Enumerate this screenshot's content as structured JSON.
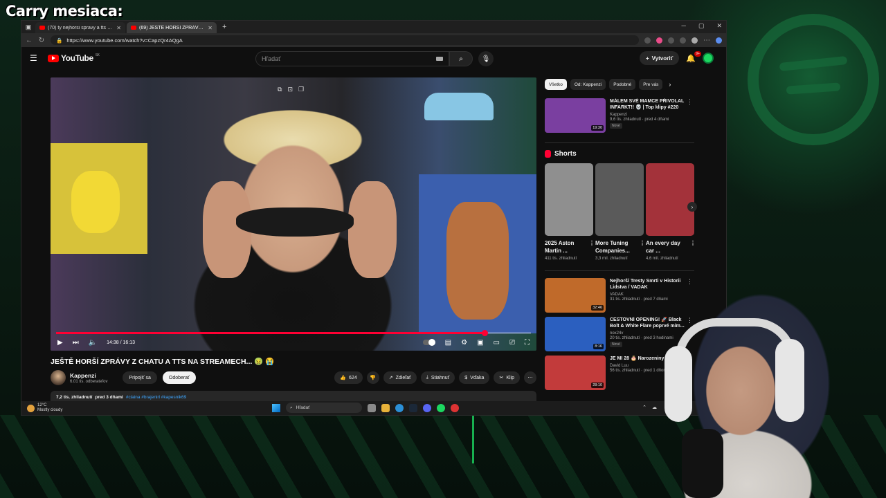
{
  "overlay": {
    "title": "Carry mesiaca:"
  },
  "browser": {
    "tabs": [
      {
        "label": "(70) ty nejhorsi spravy a tts na stream",
        "active": false
      },
      {
        "label": "(69) JEŠTĚ HORŠÍ ZPRÁVY Z CHATU A TTS",
        "active": true
      }
    ],
    "url": "https://www.youtube.com/watch?v=CapzQr4AQgA"
  },
  "youtube": {
    "logo_text": "YouTube",
    "logo_suffix": "SK",
    "search_placeholder": "Hľadať",
    "create_label": "Vytvoriť",
    "notification_count": "9+",
    "player": {
      "time_current": "14:38",
      "time_total": "16:13",
      "progress_fraction": 0.902
    },
    "video": {
      "title": "JEŠTĚ HORŠÍ ZPRÁVY Z CHATU A TTS NA STREAMECH... 🤢 😭",
      "channel": "Kappenzi",
      "subscribers": "6,01 tis. odberateľov",
      "join_label": "Pripojiť sa",
      "subscribe_label": "Odoberať",
      "likes": "624",
      "share_label": "Zdieľať",
      "download_label": "Stiahnuť",
      "thanks_label": "Vďaka",
      "clip_label": "Klip",
      "views": "7,2 tis. zhliadnutí",
      "posted": "pred 3 dňami",
      "tags": "#claina #brajenirl #kapesnik69"
    },
    "chips": [
      "Všetko",
      "Od: Kappenzi",
      "Podobné",
      "Pre vás"
    ],
    "recommended_top": {
      "title": "MÁLEM SVÉ MAMCE PŘIVOLAL INFARKT!! 💀 | Top klipy #220",
      "channel": "Kappenzi",
      "stats": "9,6 tis. zhliadnutí · pred 4 dňami",
      "badge": "Nové",
      "duration": "19:30",
      "thumb_color": "#7a3fa0"
    },
    "shorts_heading": "Shorts",
    "shorts": [
      {
        "title": "2025 Aston Martin ...",
        "stats": "411 tis. zhliadnutí",
        "thumb_color": "#8f8f8f"
      },
      {
        "title": "More Tuning Companies...",
        "stats": "3,3 mil. zhliadnutí",
        "thumb_color": "#5a5a5a"
      },
      {
        "title": "An every day car ...",
        "stats": "4,6 mil. zhliadnutí",
        "thumb_color": "#a3323a"
      }
    ],
    "recommended": [
      {
        "title": "Nejhorší Tresty Smrti v Historii Lidstva / VADAK",
        "channel": "VADAK",
        "stats": "31 tis. zhliadnutí · pred 7 dňami",
        "badge": "",
        "duration": "32:46",
        "thumb_color": "#c06a2a"
      },
      {
        "title": "CESTOVNÍ OPENING! 🚀 Black Bolt & White Flare poprvé mím...",
        "channel": "nox24v",
        "stats": "20 tis. zhliadnutí · pred 3 hodinami",
        "badge": "Nové",
        "duration": "8:16",
        "thumb_color": "#2b5fbf"
      },
      {
        "title": "JE MI 28 🎂 Narozeniny týden",
        "channel": "David Luu",
        "stats": "56 tis. zhliadnutí · pred 1 dňom",
        "badge": "",
        "duration": "28:10",
        "thumb_color": "#c23b3b"
      }
    ]
  },
  "taskbar": {
    "temp": "12°C",
    "weather": "Mostly cloudy",
    "search_placeholder": "Hľadať"
  }
}
